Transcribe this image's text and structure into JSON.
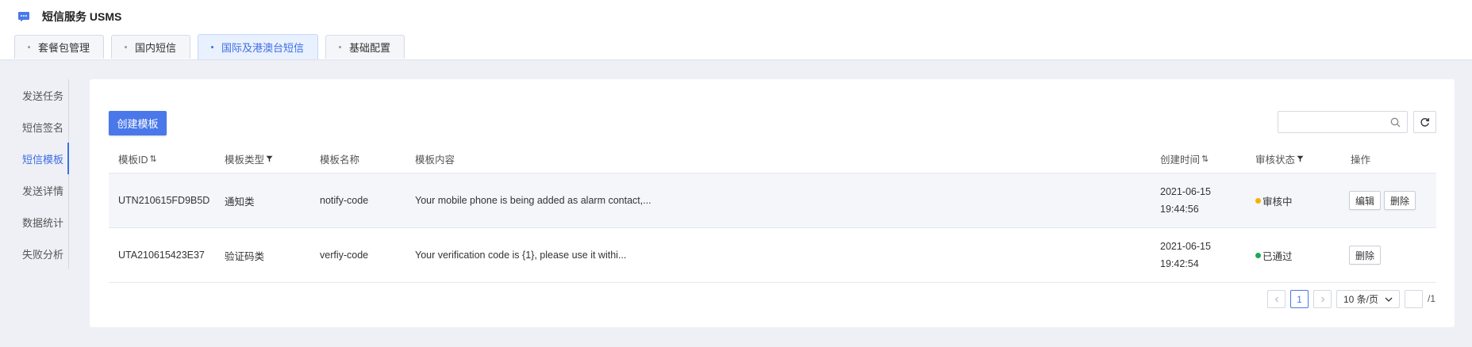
{
  "app": {
    "title": "短信服务 USMS"
  },
  "tabs": [
    {
      "label": "套餐包管理",
      "active": false
    },
    {
      "label": "国内短信",
      "active": false
    },
    {
      "label": "国际及港澳台短信",
      "active": true
    },
    {
      "label": "基础配置",
      "active": false
    }
  ],
  "sidebar": {
    "items": [
      {
        "label": "发送任务",
        "active": false
      },
      {
        "label": "短信签名",
        "active": false
      },
      {
        "label": "短信模板",
        "active": true
      },
      {
        "label": "发送详情",
        "active": false
      },
      {
        "label": "数据统计",
        "active": false
      },
      {
        "label": "失败分析",
        "active": false
      }
    ]
  },
  "toolbar": {
    "create_label": "创建模板",
    "search_value": "",
    "search_placeholder": "",
    "search_icon": "search-icon",
    "refresh_icon": "refresh-icon"
  },
  "table": {
    "headers": {
      "id": "模板ID",
      "type": "模板类型",
      "name": "模板名称",
      "content": "模板内容",
      "created": "创建时间",
      "status": "审核状态",
      "ops": "操作"
    },
    "rows": [
      {
        "id": "UTN210615FD9B5D",
        "type": "通知类",
        "name": "notify-code",
        "content": "Your mobile phone is being added as alarm contact,...",
        "date": "2021-06-15",
        "time": "19:44:56",
        "status": "审核中",
        "status_color": "#f5b300",
        "edit_label": "编辑",
        "delete_label": "删除"
      },
      {
        "id": "UTA210615423E37",
        "type": "验证码类",
        "name": "verfiy-code",
        "content": "Your verification code is {1}, please use it withi...",
        "date": "2021-06-15",
        "time": "19:42:54",
        "status": "已通过",
        "status_color": "#1ca854",
        "delete_label": "删除"
      }
    ]
  },
  "pagination": {
    "current_page": "1",
    "page_size": "10 条/页",
    "jump_value": "",
    "total_pages": "/1"
  },
  "colors": {
    "accent": "#4a78ea",
    "active_tab_bg": "#e9f1ff"
  }
}
